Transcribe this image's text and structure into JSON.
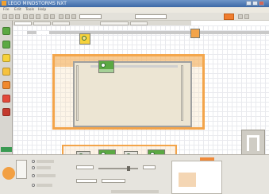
{
  "window": {
    "title": "LEGO MINDSTORMS NXT"
  },
  "menu": {
    "items": [
      "File",
      "Edit",
      "Tools",
      "Help"
    ]
  },
  "colors": {
    "titlebar": "#3c68a6",
    "accent_orange": "#f3a44a",
    "block_green": "#5ba943",
    "block_yellow": "#f6d23c",
    "block_orange": "#f0892c",
    "block_red": "#e2483a",
    "palette_bg": "#d8d6d0",
    "canvas_grid": "#e9eaee"
  },
  "palette": {
    "icons": [
      "move-block-icon",
      "record-play-icon",
      "sound-block-icon",
      "display-block-icon",
      "wait-block-icon",
      "loop-block-icon",
      "switch-block-icon"
    ]
  },
  "program": {
    "blocks": [
      "loop-block",
      "switch-block",
      "motor-block",
      "motor-block",
      "motor-block",
      "sound-block",
      "motor-block"
    ]
  }
}
